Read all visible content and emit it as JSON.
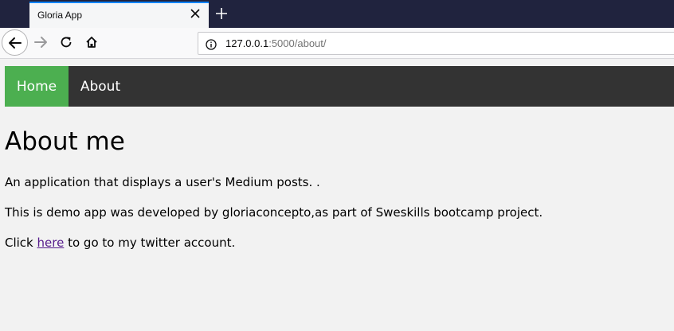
{
  "browser": {
    "tab_title": "Gloria App",
    "url_host": "127.0.0.1",
    "url_rest": ":5000/about/"
  },
  "icons": {
    "tab_close": "close-icon",
    "new_tab": "plus-icon",
    "back": "arrow-left-icon",
    "forward": "arrow-right-icon",
    "reload": "reload-icon",
    "home": "home-icon",
    "site_info": "info-icon"
  },
  "colors": {
    "tabstrip": "#20233e",
    "active_tab_accent": "#0a84ff",
    "nav_bg": "#333333",
    "nav_active": "#4caf50",
    "link_visited": "#551a8b"
  },
  "nav": {
    "home": "Home",
    "about": "About"
  },
  "content": {
    "heading": "About me",
    "p1": "An application that displays a user's Medium posts. .",
    "p2": "This is demo app was developed by gloriaconcepto,as part of Sweskills bootcamp project.",
    "p3_before": "Click ",
    "p3_link": "here",
    "p3_after": " to go to my twitter account."
  }
}
